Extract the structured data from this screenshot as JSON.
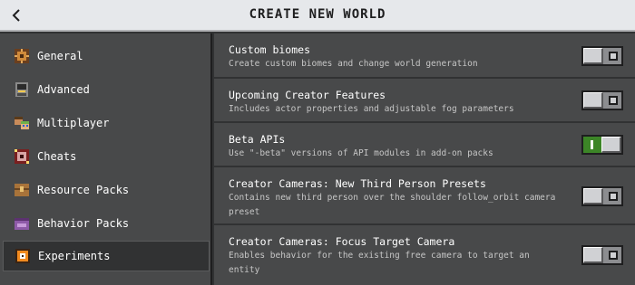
{
  "header": {
    "title": "CREATE NEW WORLD",
    "back_icon": "chevron-left-icon"
  },
  "sidebar": {
    "items": [
      {
        "label": "General",
        "icon": "general-icon",
        "active": false
      },
      {
        "label": "Advanced",
        "icon": "advanced-icon",
        "active": false
      },
      {
        "label": "Multiplayer",
        "icon": "multiplayer-icon",
        "active": false
      },
      {
        "label": "Cheats",
        "icon": "cheats-icon",
        "active": false
      },
      {
        "label": "Resource Packs",
        "icon": "resource-packs-icon",
        "active": false
      },
      {
        "label": "Behavior Packs",
        "icon": "behavior-packs-icon",
        "active": false
      },
      {
        "label": "Experiments",
        "icon": "experiments-icon",
        "active": true
      }
    ]
  },
  "experiments": [
    {
      "title": "Custom biomes",
      "description": "Create custom biomes and change world generation",
      "enabled": false
    },
    {
      "title": "Upcoming Creator Features",
      "description": "Includes actor properties and adjustable fog parameters",
      "enabled": false
    },
    {
      "title": "Beta APIs",
      "description": "Use \"-beta\" versions of API modules in add-on packs",
      "enabled": true
    },
    {
      "title": "Creator Cameras: New Third Person Presets",
      "description": "Contains new third person over the shoulder follow_orbit camera preset",
      "enabled": false
    },
    {
      "title": "Creator Cameras: Focus Target Camera",
      "description": "Enables behavior for the existing free camera to target an entity",
      "enabled": false
    }
  ],
  "colors": {
    "header_bg": "#e6e8eb",
    "panel_bg": "#48494a",
    "toggle_on": "#3c8527",
    "toggle_off": "#8c8d90"
  }
}
